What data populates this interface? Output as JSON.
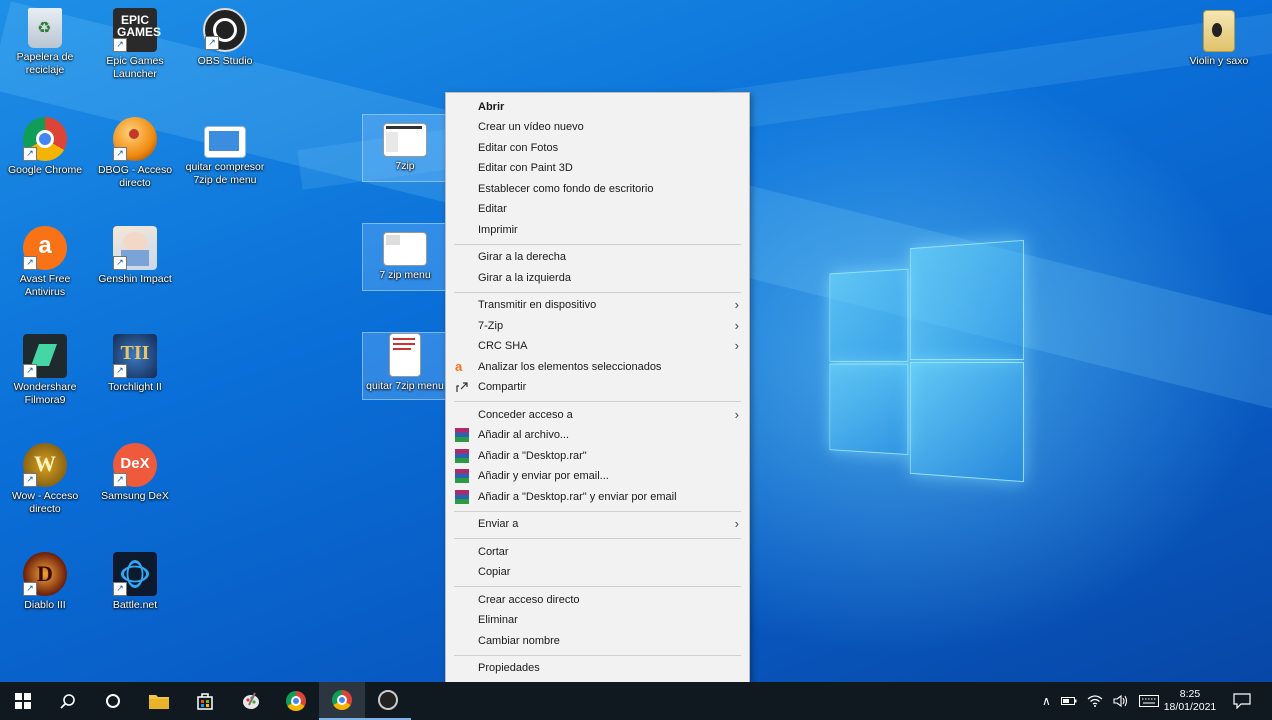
{
  "desktop_icons": [
    {
      "label": "Papelera de reciclaje",
      "icon": "recycle-bin-icon",
      "shortcut": false
    },
    {
      "label": "Epic Games Launcher",
      "icon": "epic-games-icon",
      "shortcut": true,
      "logo_text": "EPIC GAMES"
    },
    {
      "label": "OBS Studio",
      "icon": "obs-icon",
      "shortcut": true
    },
    {
      "label": "Google Chrome",
      "icon": "chrome-icon",
      "shortcut": true
    },
    {
      "label": "DBOG - Acceso directo",
      "icon": "dbog-icon",
      "shortcut": true
    },
    {
      "label": "quitar compresor 7zip de menu",
      "icon": "image-file-icon",
      "shortcut": false
    },
    {
      "label": "Avast Free Antivirus",
      "icon": "avast-icon",
      "shortcut": true
    },
    {
      "label": "Genshin Impact",
      "icon": "genshin-icon",
      "shortcut": true
    },
    {
      "label": "Wondershare Filmora9",
      "icon": "filmora-icon",
      "shortcut": true
    },
    {
      "label": "Torchlight II",
      "icon": "torchlight-icon",
      "shortcut": true
    },
    {
      "label": "Wow - Acceso directo",
      "icon": "wow-icon",
      "shortcut": true
    },
    {
      "label": "Samsung DeX",
      "icon": "dex-icon",
      "shortcut": true,
      "logo_text": "DeX"
    },
    {
      "label": "Diablo III",
      "icon": "diablo-icon",
      "shortcut": true
    },
    {
      "label": "Battle.net",
      "icon": "battlenet-icon",
      "shortcut": true
    },
    {
      "label": "7zip",
      "icon": "screenshot-file-icon",
      "selected": true
    },
    {
      "label": "7 zip menu",
      "icon": "screenshot-file-icon",
      "selected": true
    },
    {
      "label": "quitar 7zip menu",
      "icon": "screenshot-file-icon",
      "selected": true
    },
    {
      "label": "Violin y saxo",
      "icon": "folder-icon",
      "shortcut": false
    }
  ],
  "context_menu": {
    "items": [
      {
        "label": "Abrir",
        "bold": true
      },
      {
        "label": "Crear un vídeo nuevo"
      },
      {
        "label": "Editar con Fotos"
      },
      {
        "label": "Editar con Paint 3D"
      },
      {
        "label": "Establecer como fondo de escritorio"
      },
      {
        "label": "Editar"
      },
      {
        "label": "Imprimir"
      },
      {
        "label": "Girar a la derecha"
      },
      {
        "label": "Girar a la izquierda"
      },
      {
        "label": "Transmitir en dispositivo",
        "submenu": true
      },
      {
        "label": "7-Zip",
        "submenu": true
      },
      {
        "label": "CRC SHA",
        "submenu": true
      },
      {
        "label": "Analizar los elementos seleccionados",
        "icon": "avast-icon"
      },
      {
        "label": "Compartir",
        "icon": "share-icon"
      },
      {
        "label": "Conceder acceso a",
        "submenu": true
      },
      {
        "label": "Añadir al archivo...",
        "icon": "winrar-icon"
      },
      {
        "label": "Añadir a \"Desktop.rar\"",
        "icon": "winrar-icon"
      },
      {
        "label": "Añadir y enviar por email...",
        "icon": "winrar-icon"
      },
      {
        "label": "Añadir a \"Desktop.rar\" y enviar por email",
        "icon": "winrar-icon"
      },
      {
        "label": "Enviar a",
        "submenu": true
      },
      {
        "label": "Cortar"
      },
      {
        "label": "Copiar"
      },
      {
        "label": "Crear acceso directo"
      },
      {
        "label": "Eliminar"
      },
      {
        "label": "Cambiar nombre"
      },
      {
        "label": "Propiedades"
      }
    ]
  },
  "taskbar": {
    "buttons": [
      "start-icon",
      "search-icon",
      "cortana-icon",
      "file-explorer-icon",
      "store-icon",
      "paint-icon",
      "chrome-icon",
      "chrome-icon",
      "obs-icon"
    ],
    "tray": {
      "time": "8:25",
      "date": "18/01/2021"
    }
  },
  "colors": {
    "accent": "#0a6fd8",
    "taskbar": "#101820",
    "menu_bg": "#f2f2f2"
  }
}
